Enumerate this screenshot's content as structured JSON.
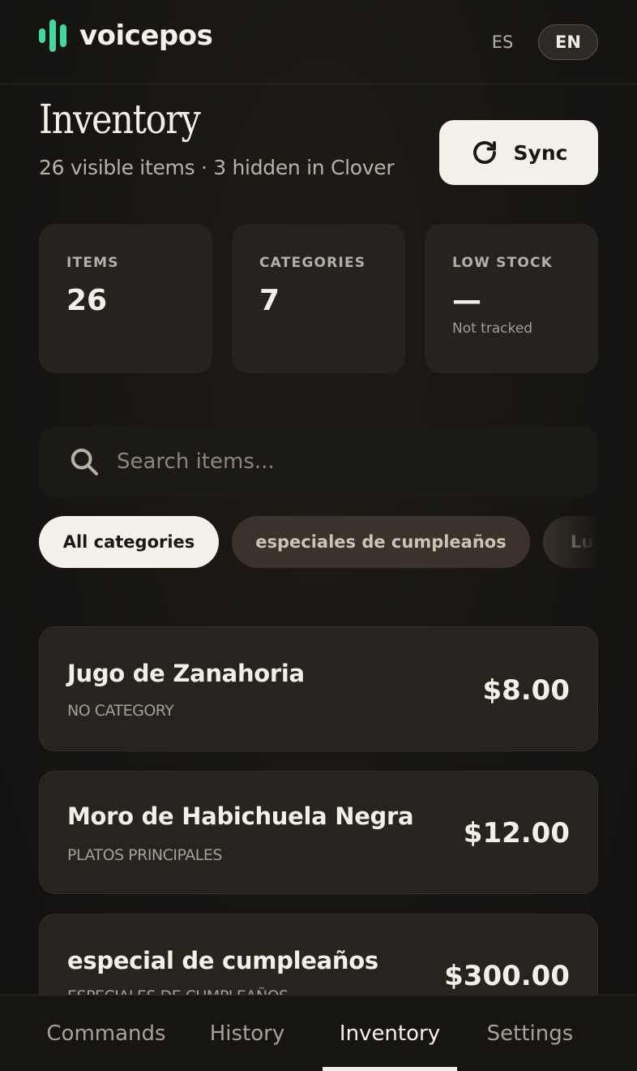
{
  "header": {
    "brand": "voicepos",
    "brand_color": "#3fd9a0",
    "languages": [
      {
        "label": "ES",
        "active": false
      },
      {
        "label": "EN",
        "active": true
      }
    ]
  },
  "page": {
    "title": "Inventory",
    "subtitle": "26 visible items · 3 hidden in Clover",
    "sync_label": "Sync"
  },
  "stats": [
    {
      "label": "ITEMS",
      "value": "26",
      "note": ""
    },
    {
      "label": "CATEGORIES",
      "value": "7",
      "note": ""
    },
    {
      "label": "LOW STOCK",
      "value": "—",
      "note": "Not tracked"
    }
  ],
  "search": {
    "placeholder": "Search items...",
    "value": ""
  },
  "categories": [
    {
      "label": "All categories",
      "selected": true
    },
    {
      "label": "especiales de cumpleaños",
      "selected": false
    },
    {
      "label": "Lu",
      "selected": false
    }
  ],
  "items": [
    {
      "name": "Jugo de Zanahoria",
      "category": "NO CATEGORY",
      "price": "$8.00"
    },
    {
      "name": "Moro de Habichuela Negra",
      "category": "PLATOS PRINCIPALES",
      "price": "$12.00"
    },
    {
      "name": "especial de cumpleaños",
      "category": "ESPECIALES DE CUMPLEAÑOS",
      "price": "$300.00"
    }
  ],
  "nav": {
    "tabs": [
      {
        "label": "Commands",
        "active": false
      },
      {
        "label": "History",
        "active": false
      },
      {
        "label": "Inventory",
        "active": true
      },
      {
        "label": "Settings",
        "active": false
      }
    ]
  },
  "icons": {
    "sync": "refresh-icon",
    "search": "search-icon"
  }
}
